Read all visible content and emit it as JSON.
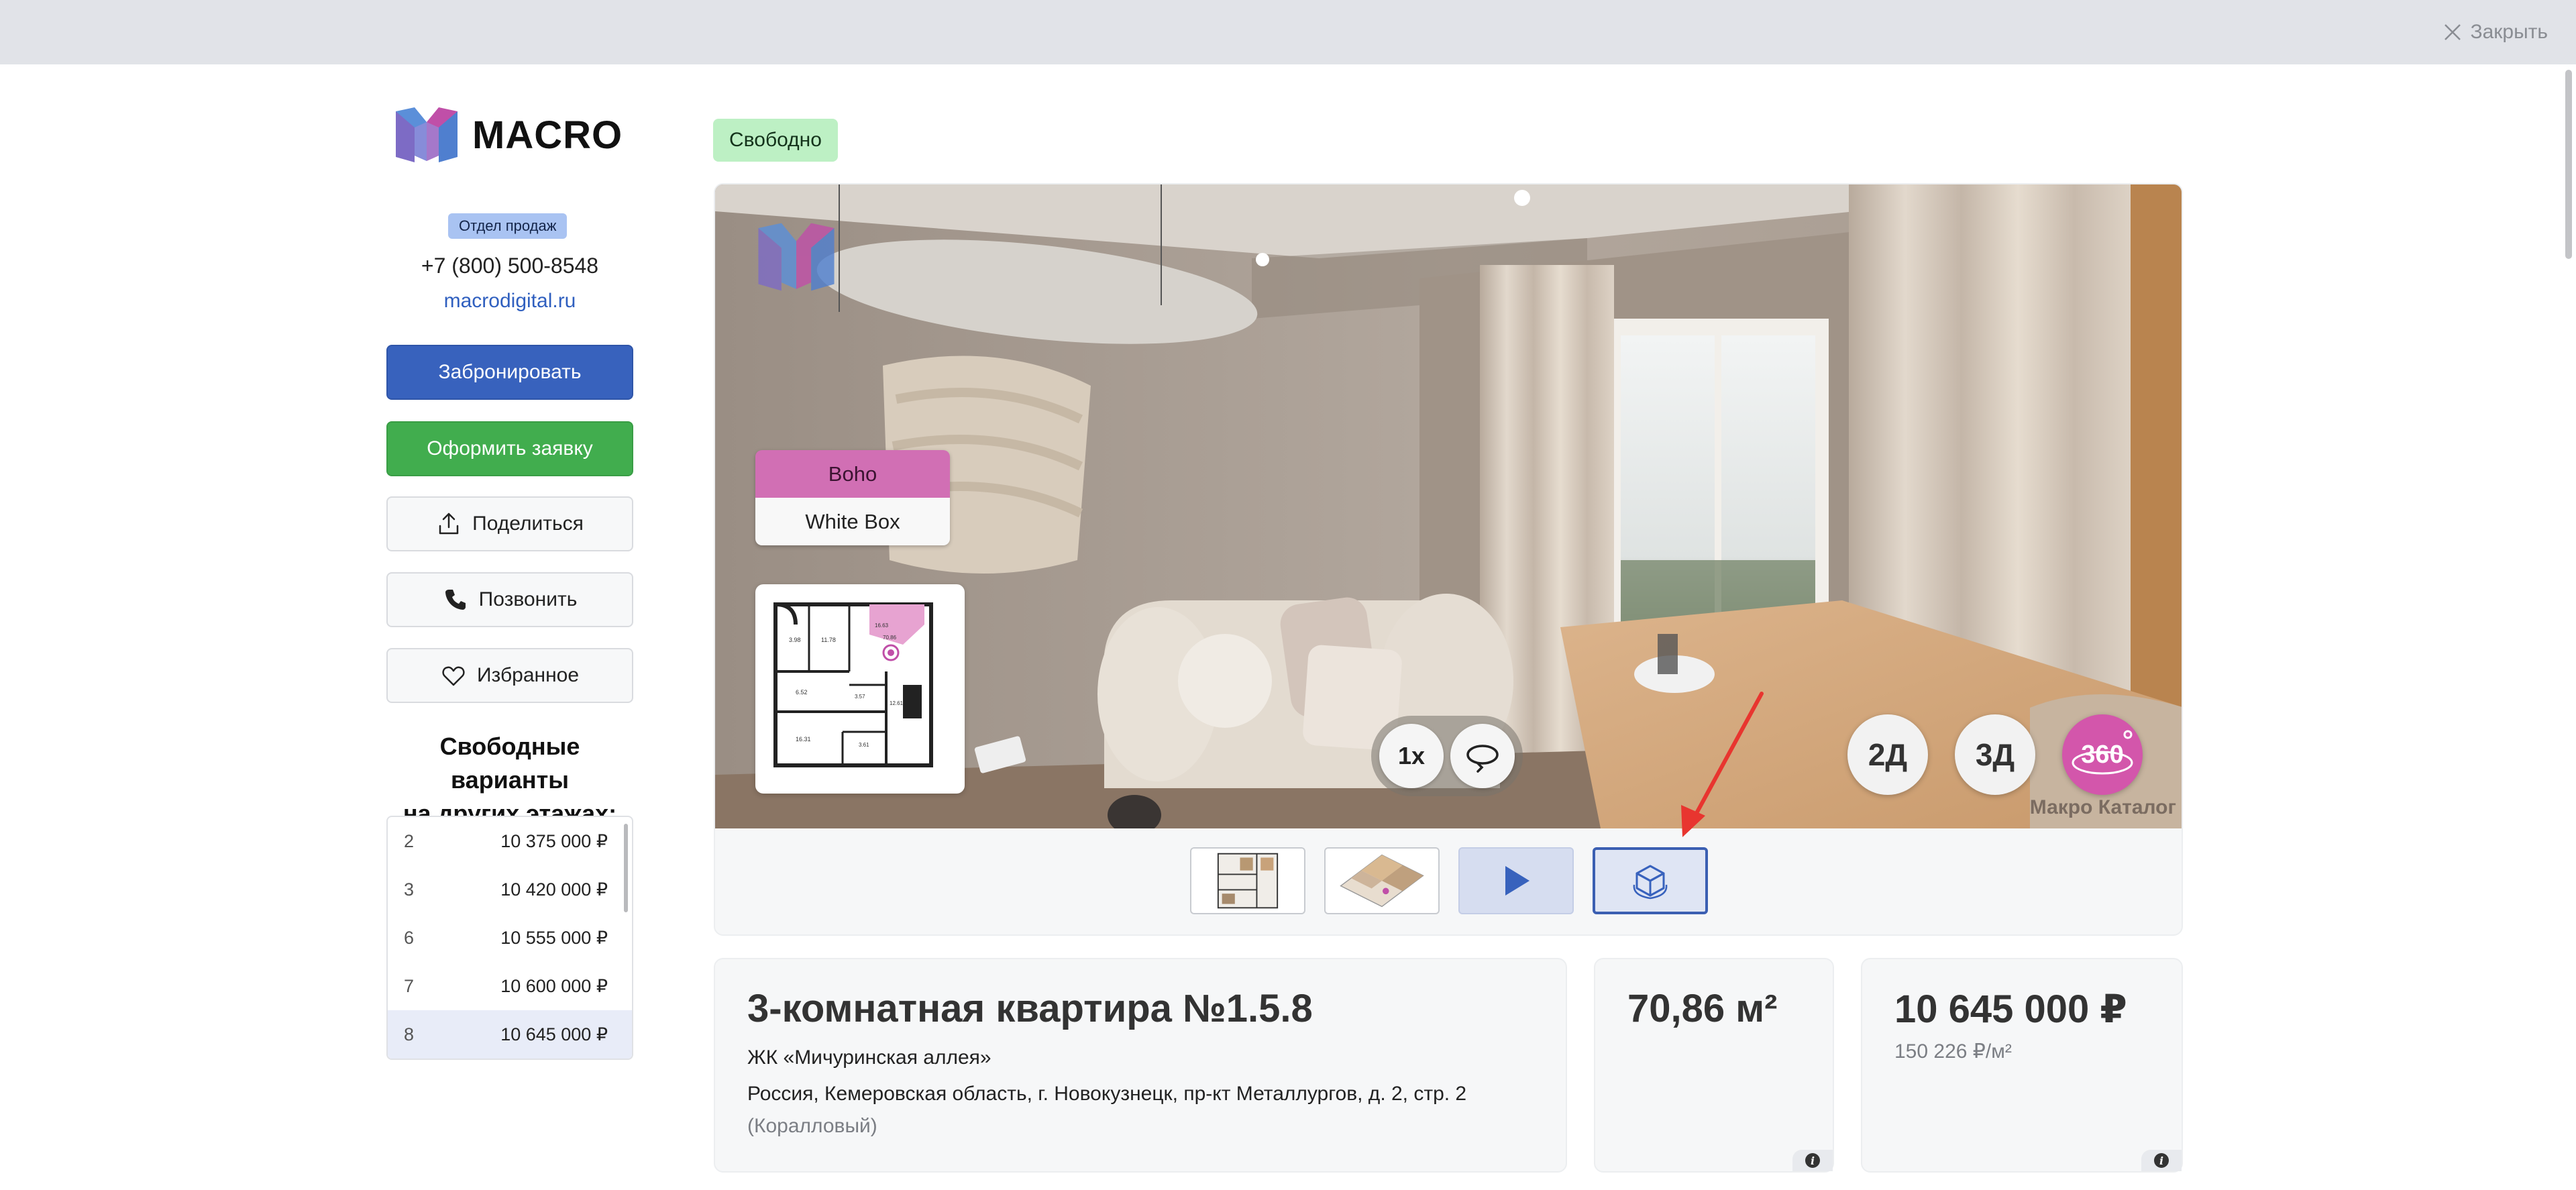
{
  "topbar": {
    "close_label": "Закрыть"
  },
  "brand": {
    "name": "MACRO"
  },
  "contacts": {
    "dept_badge": "Отдел продаж",
    "phone": "+7 (800) 500-8548",
    "site": "macrodigital.ru"
  },
  "actions": {
    "book": "Забронировать",
    "apply": "Оформить заявку",
    "share": "Поделиться",
    "call": "Позвонить",
    "favorite": "Избранное"
  },
  "other_floors": {
    "title_line1": "Свободные варианты",
    "title_line2": "на других этажах:",
    "rows": [
      {
        "floor": "2",
        "price": "10 375 000 ₽"
      },
      {
        "floor": "3",
        "price": "10 420 000 ₽"
      },
      {
        "floor": "6",
        "price": "10 555 000 ₽"
      },
      {
        "floor": "7",
        "price": "10 600 000 ₽"
      },
      {
        "floor": "8",
        "price": "10 645 000 ₽"
      }
    ]
  },
  "status": "Свободно",
  "viewer": {
    "styles": [
      "Boho",
      "White Box"
    ],
    "speed_label": "1x",
    "modes": [
      "2Д",
      "3Д",
      "360"
    ],
    "vendor_mark": "Макро Каталог",
    "plan_labels": [
      "3.98",
      "11.78",
      "16.63",
      "6.52",
      "3.57",
      "12.61",
      "16.31",
      "70.86",
      "3.61"
    ],
    "icons": {
      "rotate": "rotate-icon",
      "play": "play-icon",
      "cube": "cube-3d-icon"
    }
  },
  "apartment": {
    "title": "3-комнатная квартира №1.5.8",
    "complex": "ЖК «Мичуринская аллея»",
    "address": "Россия, Кемеровская область, г. Новокузнецк, пр-кт Металлургов, д. 2, стр. 2",
    "address_sub": "(Коралловый)",
    "area": "70,86 м²",
    "price": "10 645 000 ₽",
    "price_per_m2": "150 226 ₽/м²",
    "info_glyph": "i"
  },
  "colors": {
    "accent_blue": "#3862bd",
    "accent_green": "#41ad4e",
    "accent_pink": "#d356ab",
    "status_green": "#bdf0c4",
    "annotation_red": "#e8352f"
  }
}
